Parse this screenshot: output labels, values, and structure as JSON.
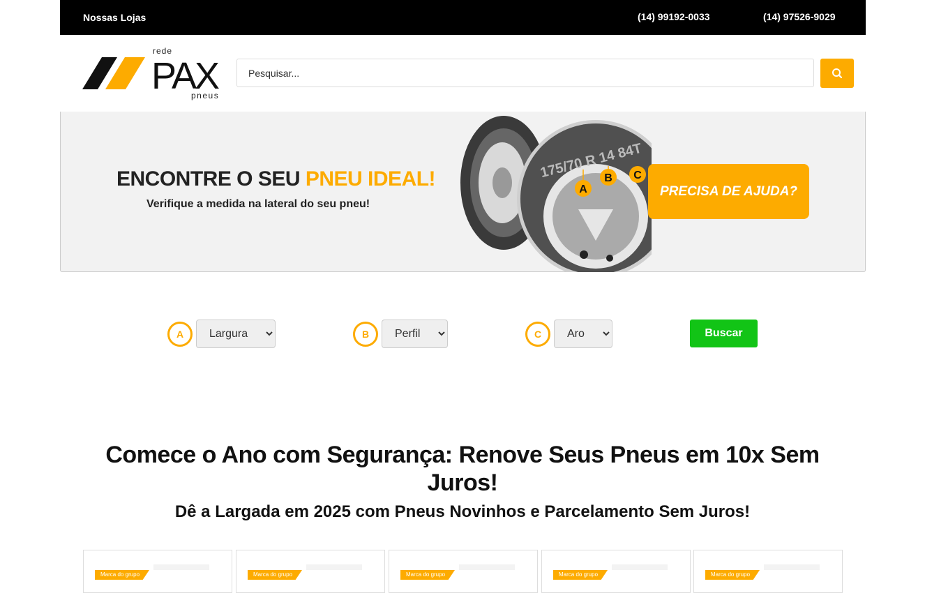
{
  "topbar": {
    "stores_label": "Nossas Lojas",
    "phone_1": "(14) 99192-0033",
    "phone_2": "(14) 97526-9029"
  },
  "logo": {
    "top_text": "rede",
    "main_text": "PAX",
    "bottom_text": "pneus"
  },
  "search": {
    "placeholder": "Pesquisar...",
    "icon": "search-icon"
  },
  "banner": {
    "headline_part1": "ENCONTRE O SEU ",
    "headline_highlight": "PNEU IDEAL!",
    "subtitle": "Verifique a medida na lateral do seu pneu!",
    "tire_marking": "175/70 R 14 84T",
    "tire_letters": [
      "A",
      "B",
      "C"
    ],
    "help_button": "PRECISA DE AJUDA?"
  },
  "filters": {
    "width": {
      "badge": "A",
      "selected": "Largura"
    },
    "profile": {
      "badge": "B",
      "selected": "Perfil"
    },
    "rim": {
      "badge": "C",
      "selected": "Aro"
    },
    "search_button": "Buscar"
  },
  "promo": {
    "title": "Comece o Ano com Segurança: Renove Seus Pneus em 10x Sem Juros!",
    "subtitle": "Dê a Largada em 2025 com Pneus Novinhos e Parcelamento Sem Juros!"
  },
  "cards": [
    {
      "tag": "Marca do grupo"
    },
    {
      "tag": "Marca do grupo"
    },
    {
      "tag": "Marca do grupo"
    },
    {
      "tag": "Marca do grupo"
    },
    {
      "tag": "Marca do grupo"
    }
  ],
  "colors": {
    "accent": "#fdab00",
    "buscar": "#12c416",
    "topbar": "#000000"
  }
}
